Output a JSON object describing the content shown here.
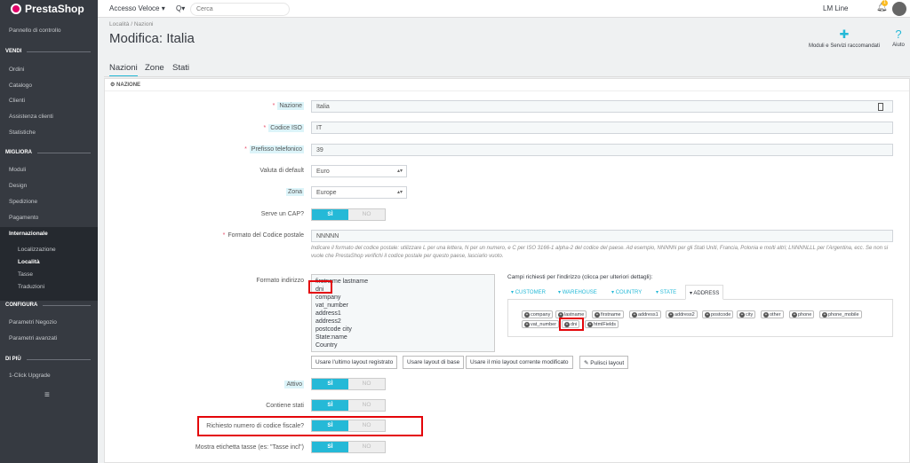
{
  "topbar": {
    "logo": "PrestaShop",
    "quick_access": "Accesso Veloce ▾",
    "search_icon": "Q▾",
    "search_placeholder": "Cerca",
    "user": "LM Line",
    "notifications_badge": "1"
  },
  "sidebar": {
    "dashboard": "Pannello di controllo",
    "sections": [
      {
        "title": "VENDI",
        "items": [
          "Ordini",
          "Catalogo",
          "Clienti",
          "Assistenza clienti",
          "Statistiche"
        ]
      },
      {
        "title": "MIGLIORA",
        "items": [
          "Moduli",
          "Design",
          "Spedizione",
          "Pagamento",
          "Internazionale"
        ]
      },
      {
        "title": "CONFIGURA",
        "items": [
          "Parametri Negozio",
          "Parametri avanzati"
        ]
      },
      {
        "title": "DI PIÙ",
        "items": [
          "1-Click Upgrade"
        ]
      }
    ],
    "sub_items": [
      "Localizzazione",
      "Località",
      "Tasse",
      "Traduzioni"
    ],
    "active_sub": "Località",
    "toggle_icon": "≡"
  },
  "header": {
    "breadcrumb": "Località  /  Nazioni",
    "title": "Modifica: Italia",
    "btn_modules": "Moduli e Servizi raccomandati",
    "btn_help": "Aiuto"
  },
  "tabs": [
    "Nazioni",
    "Zone",
    "Stati"
  ],
  "panel": {
    "heading": "NAZIONE",
    "labels": {
      "country": "Nazione",
      "iso": "Codice ISO",
      "phone": "Prefisso telefonico",
      "currency": "Valuta di default",
      "zone": "Zona",
      "zip_needed": "Serve un CAP?",
      "zip_format": "Formato del Codice postale",
      "address_format": "Formato indirizzo",
      "active": "Attivo",
      "contains_states": "Contiene stati",
      "need_tax_id": "Richiesto numero di codice fiscale?",
      "display_tax_label": "Mostra etichetta tasse (es: \"Tasse incl\")"
    },
    "values": {
      "country": "Italia",
      "iso": "IT",
      "phone": "39",
      "currency": "Euro",
      "zone": "Europe",
      "zip_format": "NNNNN"
    },
    "switch_yes": "SÌ",
    "switch_no": "NO",
    "zip_help": "Indicare il formato del codice postale: utilizzare L per una lettera, N per un numero, e C per ISO 3166-1 alpha-2 del codice del paese. Ad esempio, NNNNN per gli Stati Uniti, Francia, Polonia e molti altri; LNNNNLLL per l'Argentina, ecc. Se non si vuole che PrestaShop verifichi il codice postale per questo paese, lasciarlo vuoto.",
    "address_lines": [
      "firstname lastname",
      "dni",
      "company",
      "vat_number",
      "address1",
      "address2",
      "postcode city",
      "State:name",
      "Country"
    ],
    "fields_title": "Campi richiesti per l'indirizzo (clicca per ulteriori dettagli):",
    "field_tabs": [
      "CUSTOMER",
      "WAREHOUSE",
      "COUNTRY",
      "STATE",
      "ADDRESS"
    ],
    "chips": [
      "company",
      "lastname",
      "firstname",
      "address1",
      "address2",
      "postcode",
      "city",
      "other",
      "phone",
      "phone_mobile",
      "vat_number",
      "dni",
      "htmlFields"
    ],
    "buttons": {
      "last_layout": "Usare l'ultimo layout registrato",
      "base_layout": "Usare layout di base",
      "current_layout": "Usare il mio layout corrente modificato",
      "clear_layout": "Pulisci layout"
    }
  },
  "colors": {
    "accent": "#25b9d7",
    "sidebar_bg": "#363a41",
    "highlight": "#e4050a"
  }
}
